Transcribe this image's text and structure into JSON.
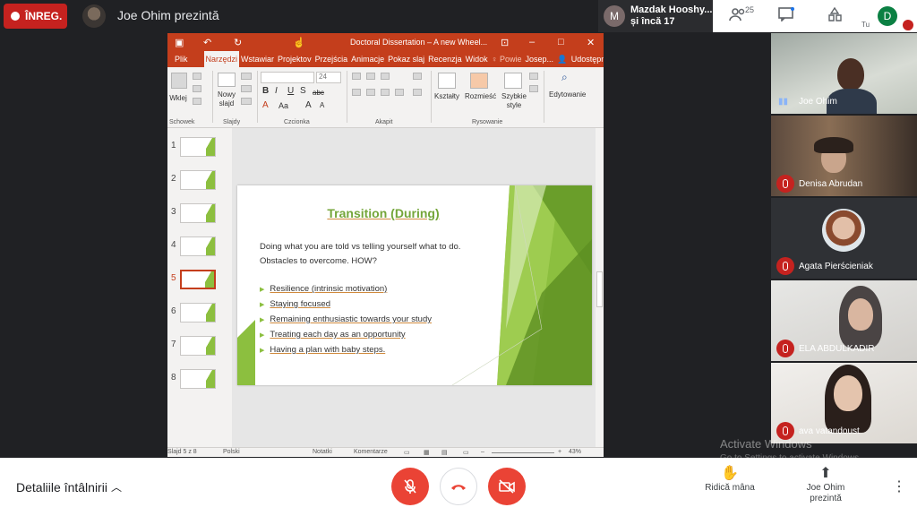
{
  "topbar": {
    "record_label": "ÎNREG.",
    "presenter_text": "Joe Ohim prezintă",
    "meeting_chip": {
      "avatar_letter": "M",
      "line1": "Mazdak Hooshy...",
      "line2": "și încă 17"
    },
    "people_count": "25",
    "self_avatar": "D",
    "self_label": "Tu"
  },
  "ppt": {
    "window_title": "Doctoral Dissertation – A new Wheel...",
    "tabs": [
      "Plik",
      "Narzędzi",
      "Wstawiar",
      "Projektov",
      "Przejścia",
      "Animacje",
      "Pokaz slaj",
      "Recenzja",
      "Widok",
      "♀ Powie",
      "Josep..."
    ],
    "active_tab": 1,
    "share": "Udostępnij",
    "ribbon": {
      "paste": "Wklej",
      "new_slide": "Nowy slajd",
      "font_size": "24",
      "shapes": "Kształty",
      "arrange": "Rozmieść",
      "quick_styles": "Szybkie style",
      "editing": "Edytowanie",
      "groups": [
        "Schowek",
        "Slajdy",
        "Czcionka",
        "Akapit",
        "Rysowanie"
      ]
    },
    "thumbs": [
      "1",
      "2",
      "3",
      "4",
      "5",
      "6",
      "7",
      "8"
    ],
    "active_slide": 5,
    "status": {
      "slide": "Slajd 5 z 8",
      "lang": "Polski",
      "notes": "Notatki",
      "comments": "Komentarze",
      "zoom": "43%"
    },
    "slide": {
      "title": "Transition (During)",
      "intro_lines": [
        "Doing what you are told vs telling yourself what to do.",
        "Obstacles to overcome. HOW?"
      ],
      "bullets": [
        "Resilience (intrinsic motivation)",
        "Staying focused",
        "Remaining enthusiastic towards your study",
        "Treating each day as an opportunity",
        "Having a plan with baby steps."
      ]
    }
  },
  "participants": [
    {
      "name": "Joe Ohim",
      "muted": false
    },
    {
      "name": "Denisa Abrudan",
      "muted": true
    },
    {
      "name": "Agata Pierścieniak",
      "muted": true
    },
    {
      "name": "ELA ABDULKADIR",
      "muted": true
    },
    {
      "name": "ava vatandoust",
      "muted": true
    }
  ],
  "watermark": {
    "line1": "Activate Windows",
    "line2": "Go to Settings to activate Windows."
  },
  "bottombar": {
    "details": "Detaliile întâlnirii",
    "raise_hand": "Ridică mâna",
    "presenting_line1": "Joe Ohim",
    "presenting_line2": "prezintă"
  },
  "colors": {
    "accent_red": "#ea4335",
    "ppt_orange": "#c43e1c",
    "slide_green": "#8cbf3f"
  }
}
